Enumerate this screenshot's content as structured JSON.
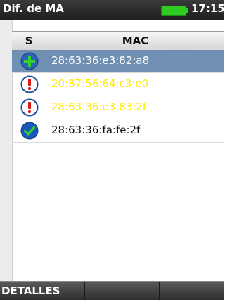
{
  "titlebar": {
    "title": "Dif. de MA",
    "time": "17:15",
    "battery_color": "#2ecc20"
  },
  "table": {
    "headers": {
      "status": "S",
      "mac": "MAC"
    },
    "rows": [
      {
        "icon": "add-icon",
        "mac": "28:63:36:e3:82:a8",
        "selected": true,
        "color": "#ffffff"
      },
      {
        "icon": "alert-icon",
        "mac": "20:87:56:64:c3:e0",
        "selected": false,
        "color": "#ffea00"
      },
      {
        "icon": "alert-icon",
        "mac": "28:63:36:e3:83:2f",
        "selected": false,
        "color": "#ffea00"
      },
      {
        "icon": "check-icon",
        "mac": "28:63:36:fa:fe:2f",
        "selected": false,
        "color": "#111111"
      }
    ]
  },
  "softkeys": {
    "key1": "DETALLES",
    "key2": "",
    "key3": ""
  }
}
